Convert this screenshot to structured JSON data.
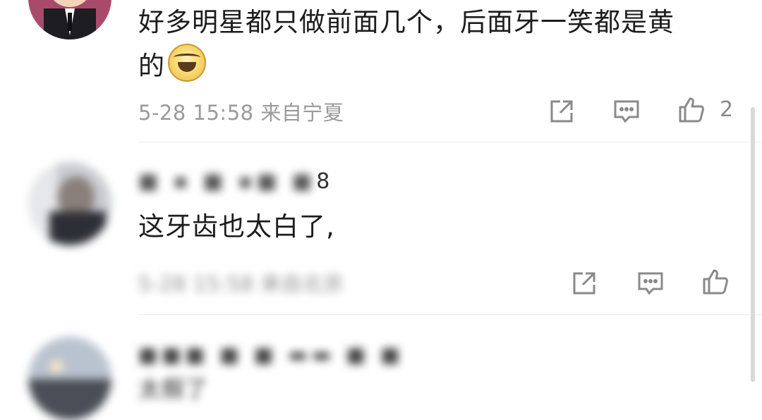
{
  "comments": [
    {
      "text_line1": "好多明星都只做前面几个，后面牙一笑都是黄",
      "text_line2": "的",
      "emoji_icon": "laugh-cry-emoji-icon",
      "meta": "5-28 15:58 来自宁夏",
      "likes": "2"
    },
    {
      "username_tail": "8",
      "text": "这牙齿也太白了,",
      "meta_blurred": "5-28 15:58 来自北京"
    },
    {
      "text_partial": "太假了"
    }
  ],
  "icons": {
    "share": "share-icon",
    "reply": "reply-icon",
    "like": "thumbs-up-icon"
  },
  "colors": {
    "text": "#1c1c1c",
    "meta": "#9a9a9a",
    "divider": "#ececec"
  }
}
